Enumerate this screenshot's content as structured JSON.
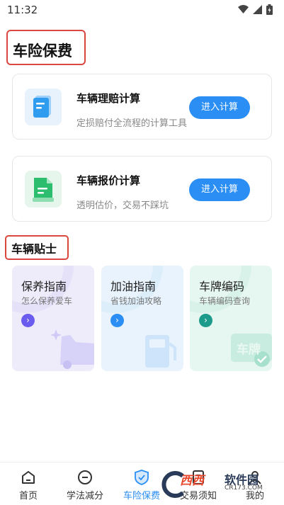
{
  "status_bar": {
    "time": "11:32",
    "icons": [
      "wifi-icon",
      "signal-icon",
      "battery-icon"
    ]
  },
  "page_title": "车险保费",
  "cards": [
    {
      "title": "车辆理赔计算",
      "subtitle": "定损赔付全流程的计算工具",
      "button": "进入计算",
      "icon": "document-blue-icon"
    },
    {
      "title": "车辆报价计算",
      "subtitle": "透明估价，交易不踩坑",
      "button": "进入计算",
      "icon": "document-green-icon"
    }
  ],
  "section_title": "车辆贴士",
  "tips": [
    {
      "title": "保养指南",
      "subtitle": "怎么保养爱车",
      "icon": "car-icon",
      "accent": "#6b5cf0",
      "bg": "#eeecfb"
    },
    {
      "title": "加油指南",
      "subtitle": "省钱加油攻略",
      "icon": "fuel-pump-icon",
      "accent": "#2a8ef4",
      "bg": "#e8f3fd"
    },
    {
      "title": "车牌编码",
      "subtitle": "车辆编码查询",
      "icon": "license-plate-icon",
      "accent": "#1c9a8a",
      "bg": "#e6f7f2",
      "deco_text": "车牌"
    }
  ],
  "bottom_nav": [
    {
      "label": "首页",
      "icon": "home-icon"
    },
    {
      "label": "学法减分",
      "icon": "minus-circle-icon"
    },
    {
      "label": "车险保费",
      "icon": "shield-icon",
      "active": true
    },
    {
      "label": "交易须知",
      "icon": "document-icon"
    },
    {
      "label": "我的",
      "icon": "user-icon"
    }
  ],
  "watermark": {
    "left": "西西",
    "right": "软件园",
    "url": "CR173.COM"
  }
}
